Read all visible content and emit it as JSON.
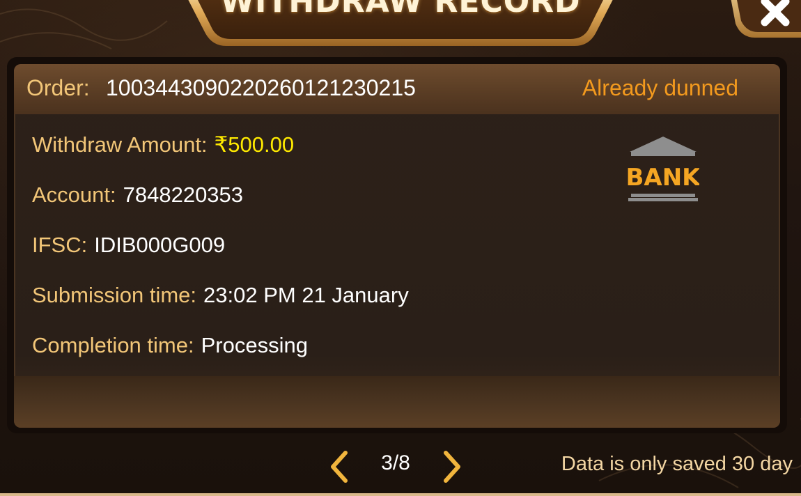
{
  "header": {
    "title": "WITHDRAW RECORD",
    "close_icon": "close-x-icon"
  },
  "record": {
    "order_label": "Order:",
    "order_number": "1003443090220260121230215",
    "status": "Already dunned",
    "fields": [
      {
        "label": "Withdraw Amount:",
        "value": "₹500.00"
      },
      {
        "label": "Account:",
        "value": "7848220353"
      },
      {
        "label": "IFSC:",
        "value": "IDIB000G009"
      },
      {
        "label": "Submission time:",
        "value": "23:02 PM 21 January"
      },
      {
        "label": "Completion time:",
        "value": "Processing"
      }
    ],
    "method_icon": "bank-icon",
    "method_icon_text": "BANK"
  },
  "pager": {
    "current": 3,
    "total": 8,
    "text": "3/8",
    "prev_icon": "chevron-left-icon",
    "next_icon": "chevron-right-icon"
  },
  "footer": {
    "note": "Data is only saved 30 day"
  },
  "colors": {
    "label": "#f2c678",
    "value": "#ffffff",
    "amount": "#ffea00",
    "status": "#f39a1e",
    "chevron": "#f1b53d"
  }
}
